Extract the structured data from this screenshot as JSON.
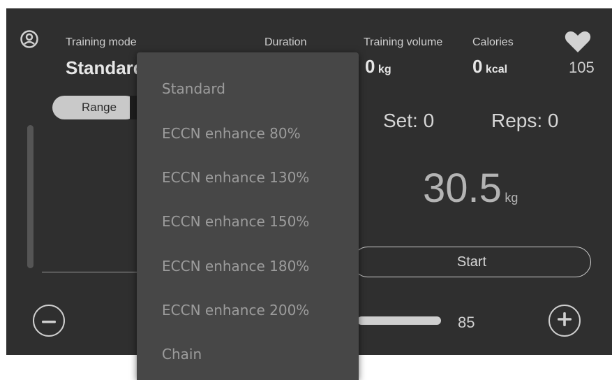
{
  "header": {
    "training_mode_label": "Training mode",
    "training_mode_value": "Standard",
    "duration_label": "Duration",
    "training_volume_label": "Training volume",
    "training_volume_value": "0",
    "training_volume_unit": "kg",
    "calories_label": "Calories",
    "calories_value": "0",
    "calories_unit": "kcal",
    "heart_rate_value": "105"
  },
  "controls": {
    "range_label": "Range",
    "set_text": "Set: 0",
    "reps_text": "Reps: 0",
    "weight_value": "30.5",
    "weight_unit": "kg",
    "start_label": "Start",
    "slider_value": "85"
  },
  "dropdown": {
    "items": [
      "Standard",
      "ECCN enhance 80%",
      "ECCN enhance 130%",
      "ECCN enhance 150%",
      "ECCN enhance 180%",
      "ECCN enhance 200%",
      "Chain"
    ]
  },
  "icons": {
    "profile": "profile-icon",
    "heart": "heart-icon",
    "minus": "minus-icon",
    "plus": "plus-icon"
  }
}
